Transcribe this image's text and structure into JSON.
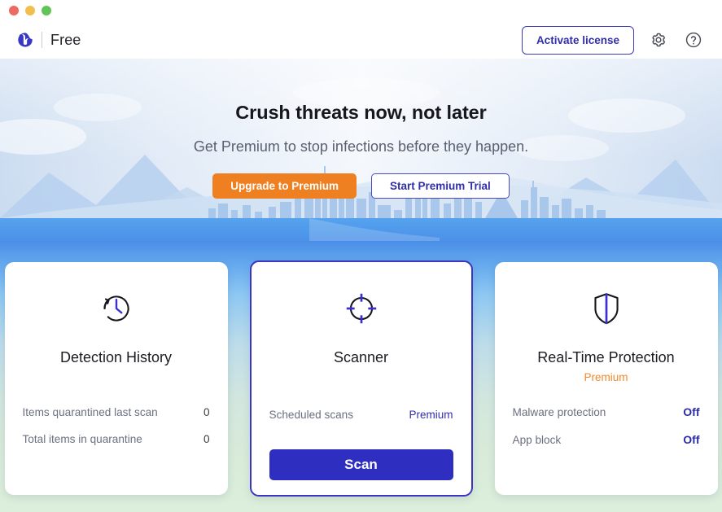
{
  "window": {
    "traffic_lights": [
      "close",
      "minimize",
      "maximize"
    ]
  },
  "header": {
    "logo_icon": "malwarebytes-logo-icon",
    "edition": "Free",
    "activate_label": "Activate license",
    "settings_icon": "gear-icon",
    "help_icon": "help-circle-icon"
  },
  "hero": {
    "title": "Crush threats now, not later",
    "subtitle": "Get Premium to stop infections before they happen.",
    "upgrade_label": "Upgrade to Premium",
    "trial_label": "Start Premium Trial",
    "accent_orange": "#ef8022",
    "accent_blue": "#312fa8"
  },
  "cards": [
    {
      "id": "detection-history",
      "icon": "clock-history-icon",
      "title": "Detection History",
      "badge": "",
      "rows": [
        {
          "label": "Items quarantined last scan",
          "value": "0",
          "style": "plain"
        },
        {
          "label": "Total items in quarantine",
          "value": "0",
          "style": "plain"
        }
      ],
      "button": ""
    },
    {
      "id": "scanner",
      "icon": "crosshair-icon",
      "title": "Scanner",
      "badge": "",
      "rows": [
        {
          "label": "Scheduled scans",
          "value": "Premium",
          "style": "blue"
        }
      ],
      "button": "Scan"
    },
    {
      "id": "real-time-protection",
      "icon": "shield-icon",
      "title": "Real-Time Protection",
      "badge": "Premium",
      "rows": [
        {
          "label": "Malware protection",
          "value": "Off",
          "style": "off"
        },
        {
          "label": "App block",
          "value": "Off",
          "style": "off"
        }
      ],
      "button": ""
    }
  ]
}
